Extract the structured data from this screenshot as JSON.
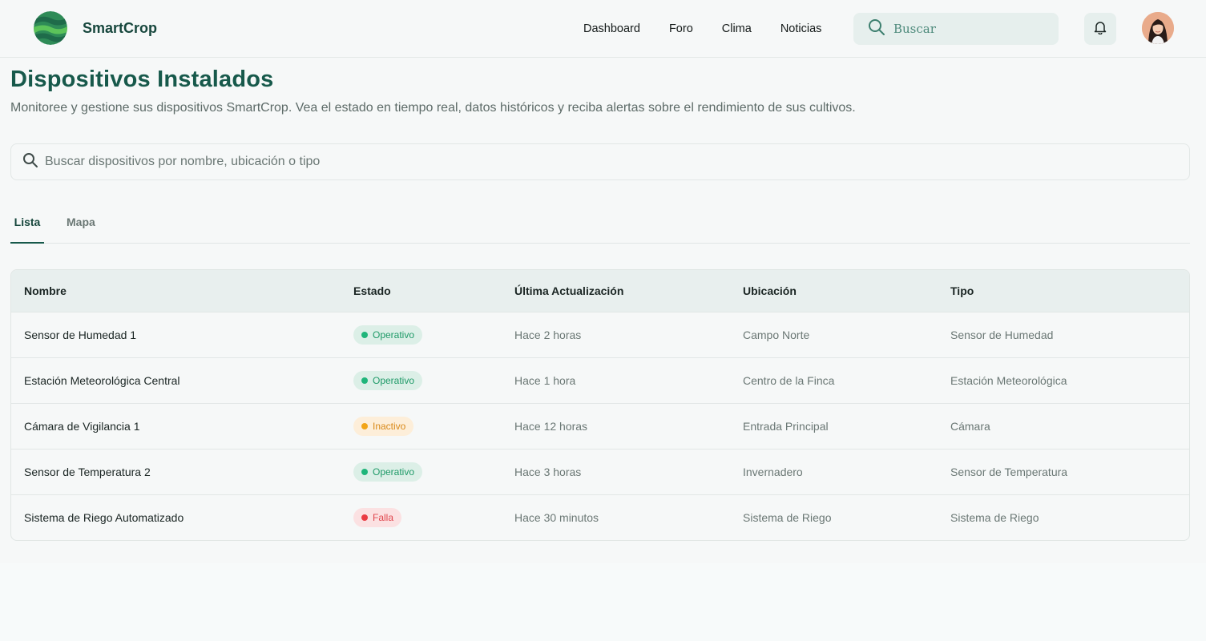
{
  "header": {
    "brand": "SmartCrop",
    "nav": [
      "Dashboard",
      "Foro",
      "Clima",
      "Noticias"
    ],
    "search_placeholder": "Buscar"
  },
  "page": {
    "title": "Dispositivos Instalados",
    "subtitle": "Monitoree y gestione sus dispositivos SmartCrop. Vea el estado en tiempo real, datos históricos y reciba alertas sobre el rendimiento de sus cultivos.",
    "search_placeholder": "Buscar dispositivos por nombre, ubicación o tipo"
  },
  "tabs": [
    "Lista",
    "Mapa"
  ],
  "table": {
    "headers": [
      "Nombre",
      "Estado",
      "Última Actualización",
      "Ubicación",
      "Tipo"
    ],
    "rows": [
      {
        "name": "Sensor de Humedad 1",
        "status": "Operativo",
        "updated": "Hace 2 horas",
        "location": "Campo Norte",
        "type": "Sensor de Humedad"
      },
      {
        "name": "Estación Meteorológica Central",
        "status": "Operativo",
        "updated": "Hace 1 hora",
        "location": "Centro de la Finca",
        "type": "Estación Meteorológica"
      },
      {
        "name": "Cámara de Vigilancia 1",
        "status": "Inactivo",
        "updated": "Hace 12 horas",
        "location": "Entrada Principal",
        "type": "Cámara"
      },
      {
        "name": "Sensor de Temperatura 2",
        "status": "Operativo",
        "updated": "Hace 3 horas",
        "location": "Invernadero",
        "type": "Sensor de Temperatura"
      },
      {
        "name": "Sistema de Riego Automatizado",
        "status": "Falla",
        "updated": "Hace 30 minutos",
        "location": "Sistema de Riego",
        "type": "Sistema de Riego"
      }
    ]
  },
  "colors": {
    "brand": "#17594b",
    "status_operativo": "#1fb57a",
    "status_inactivo": "#f2a416",
    "status_falla": "#ea3b43"
  },
  "icons": [
    "logo-icon",
    "search-icon",
    "bell-icon",
    "avatar"
  ]
}
